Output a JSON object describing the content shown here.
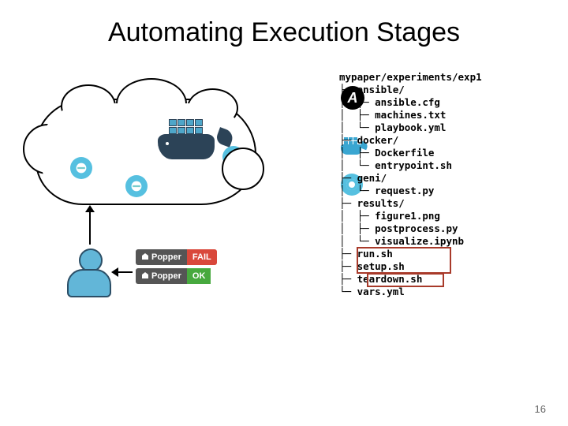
{
  "title": "Automating Execution Stages",
  "slide_number": "16",
  "badges": {
    "name": "Popper",
    "fail": "FAIL",
    "ok": "OK"
  },
  "tree": {
    "root": "mypaper/experiments/exp1",
    "ansible_dir": "ansible/",
    "ansible_files": [
      "ansible.cfg",
      "machines.txt",
      "playbook.yml"
    ],
    "docker_dir": "docker/",
    "docker_files": [
      "Dockerfile",
      "entrypoint.sh"
    ],
    "geni_dir": "geni/",
    "geni_files": [
      "request.py"
    ],
    "results_dir": "results/",
    "results_files": [
      "figure1.png",
      "postprocess.py",
      "visualize.ipynb"
    ],
    "scripts": [
      "run.sh",
      "setup.sh",
      "teardown.sh",
      "vars.yml"
    ]
  },
  "icons": {
    "ansible": "ansible-icon",
    "docker": "docker-icon",
    "geni": "geni-icon",
    "user": "user-icon",
    "cloud_node": "node-icon"
  }
}
